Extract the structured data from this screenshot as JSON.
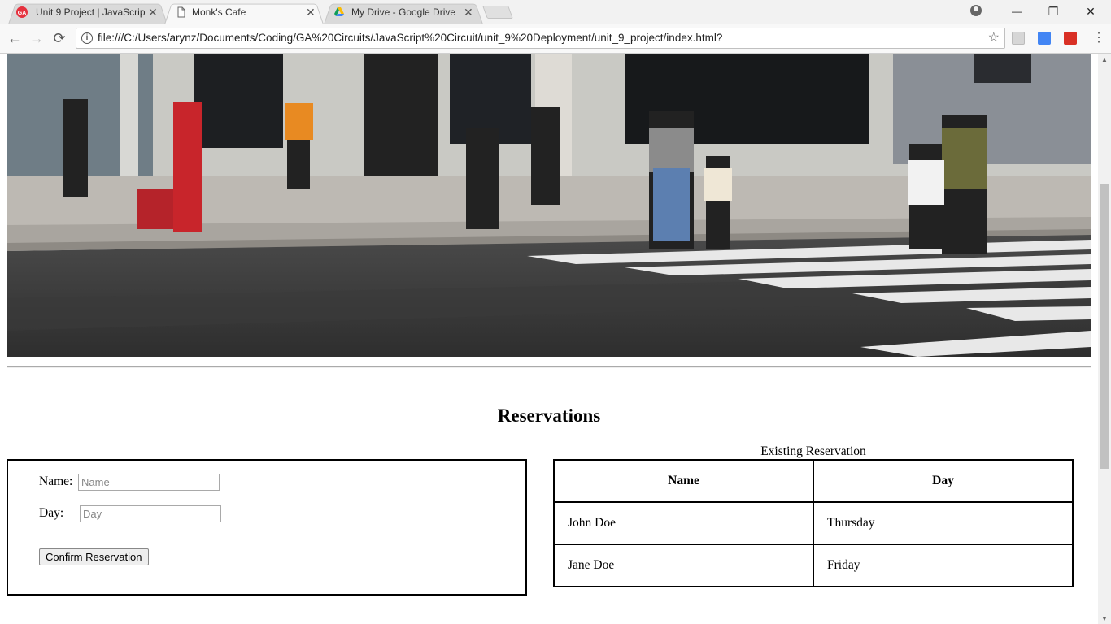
{
  "browser": {
    "tabs": [
      {
        "title": "Unit 9 Project | JavaScrip",
        "icon": "ga-logo-icon",
        "active": false
      },
      {
        "title": "Monk's Cafe",
        "icon": "document-icon",
        "active": true
      },
      {
        "title": "My Drive - Google Drive",
        "icon": "google-drive-icon",
        "active": false
      }
    ],
    "close_glyph": "✕",
    "url": "file:///C:/Users/arynz/Documents/Coding/GA%20Circuits/JavaScript%20Circuit/unit_9%20Deployment/unit_9_project/index.html?",
    "back_glyph": "←",
    "forward_glyph": "→",
    "reload_glyph": "⟳",
    "star_glyph": "☆",
    "menu_glyph": "⋮",
    "minimize_glyph": "—",
    "restore_glyph": "❐",
    "window_close_glyph": "✕",
    "extension_icons": [
      "pdf-extension-icon",
      "google-translate-icon",
      "bookmark-extension-icon"
    ]
  },
  "page": {
    "hero_image": "street-scene-photo",
    "reservations": {
      "title": "Reservations",
      "form": {
        "name_label": "Name:",
        "name_placeholder": "Name",
        "name_value": "",
        "day_label": "Day:",
        "day_placeholder": "Day",
        "day_value": "",
        "confirm_label": "Confirm Reservation"
      },
      "table": {
        "caption": "Existing Reservation",
        "headers": [
          "Name",
          "Day"
        ],
        "rows": [
          [
            "John Doe",
            "Thursday"
          ],
          [
            "Jane Doe",
            "Friday"
          ]
        ]
      }
    }
  },
  "colors": {
    "tab_active": "#f8f8f8",
    "tab_inactive": "#dadada",
    "border": "#000000"
  }
}
